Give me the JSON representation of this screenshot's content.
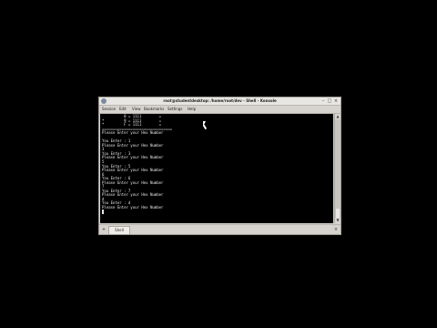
{
  "window": {
    "title": "root@studentdesktop: /home/root/dev - Shell - Konsole",
    "close_glyph": "×",
    "minimize_glyph": "–",
    "maximize_glyph": "□"
  },
  "menubar": {
    "items": [
      "Session",
      "Edit",
      "View",
      "Bookmarks",
      "Settings",
      "Help"
    ]
  },
  "terminal": {
    "lines": [
      "          8 = 1111        =",
      "*         9 = 1111        =",
      "*         F = 1111        =",
      "================================",
      "Please Enter your Hex Number",
      "",
      "You Enter : 1",
      "Please Enter your Hex Number",
      "3",
      "You Enter : 3",
      "Please Enter your Hex Number",
      "5",
      "You Enter : 5",
      "Please Enter your Hex Number",
      "6",
      "You Enter : 6",
      "Please Enter your Hex Number",
      "7",
      "You Enter : 7",
      "Please Enter your Hex Number",
      "d",
      "You Enter : d",
      "Please Enter your Hex Number",
      ""
    ]
  },
  "tabbar": {
    "tab_label": "Shell",
    "new_tab_glyph": "+",
    "close_tab_glyph": "×"
  },
  "scrollbar": {
    "up_glyph": "▲",
    "down_glyph": "▼"
  }
}
